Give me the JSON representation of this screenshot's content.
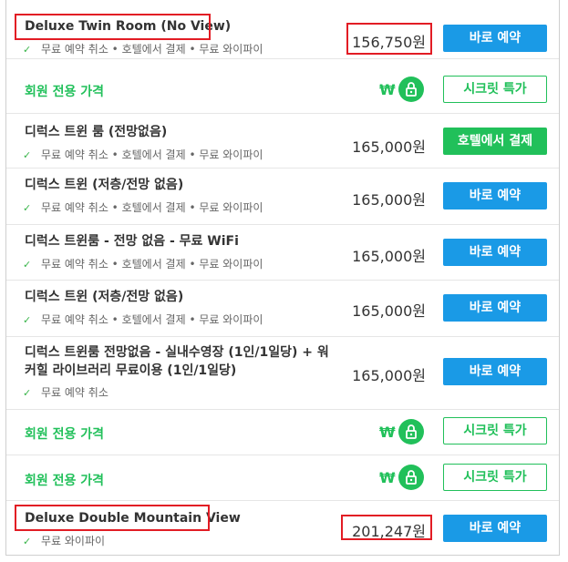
{
  "rooms": [
    {
      "title": "Deluxe Twin Room (No View)",
      "features": "무료 예약 취소 • 호텔에서 결제 • 무료 와이파이",
      "price": "156,750원",
      "button": "바로 예약"
    },
    {
      "member_label": "회원 전용 가격",
      "currency_symbol": "₩",
      "button": "시크릿 특가"
    },
    {
      "title": "디럭스 트윈 룸 (전망없음)",
      "features": "무료 예약 취소 • 호텔에서 결제 • 무료 와이파이",
      "price": "165,000원",
      "button": "호텔에서 결제"
    },
    {
      "title": "디럭스 트윈 (저층/전망 없음)",
      "features": "무료 예약 취소 • 호텔에서 결제 • 무료 와이파이",
      "price": "165,000원",
      "button": "바로 예약"
    },
    {
      "title": "디럭스 트윈룸 - 전망 없음 - 무료 WiFi",
      "features": "무료 예약 취소 • 호텔에서 결제 • 무료 와이파이",
      "price": "165,000원",
      "button": "바로 예약"
    },
    {
      "title": "디럭스 트윈 (저층/전망 없음)",
      "features": "무료 예약 취소 • 호텔에서 결제 • 무료 와이파이",
      "price": "165,000원",
      "button": "바로 예약"
    },
    {
      "title_line1": "디럭스 트윈룸 전망없음 - 실내수영장 (1인/1일당) + 워",
      "title_line2": "커힐 라이브러리 무료이용 (1인/1일당)",
      "features": "무료 예약 취소",
      "price": "165,000원",
      "button": "바로 예약"
    },
    {
      "member_label": "회원 전용 가격",
      "currency_symbol": "₩",
      "button": "시크릿 특가"
    },
    {
      "member_label": "회원 전용 가격",
      "currency_symbol": "₩",
      "button": "시크릿 특가"
    },
    {
      "title": "Deluxe Double Mountain View",
      "features": "무료 와이파이",
      "price": "201,247원",
      "button": "바로 예약"
    }
  ],
  "icons": {
    "check": "check-icon",
    "lock": "lock-icon"
  },
  "colors": {
    "book_blue": "#1a9ae6",
    "member_green": "#21c05a",
    "highlight_red": "#e21c24"
  }
}
